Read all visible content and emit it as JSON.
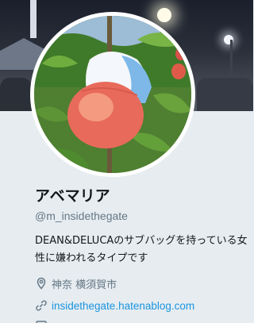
{
  "profile": {
    "display_name": "アベマリア",
    "screen_name": "@m_insidethegate",
    "bio": "DEAN&DELUCAのサブバッグを持っている女性に嫌われるタイプです",
    "location": "神奈 横須賀市",
    "url": "insidethegate.hatenablog.com"
  },
  "icons": {
    "location": "map-pin-icon",
    "url": "link-icon",
    "join_date": "calendar-icon"
  },
  "colors": {
    "name": "#14171a",
    "secondary": "#657786",
    "link": "#1b95e0",
    "card_background": "#e6ecf0",
    "avatar_border": "#ffffff"
  }
}
